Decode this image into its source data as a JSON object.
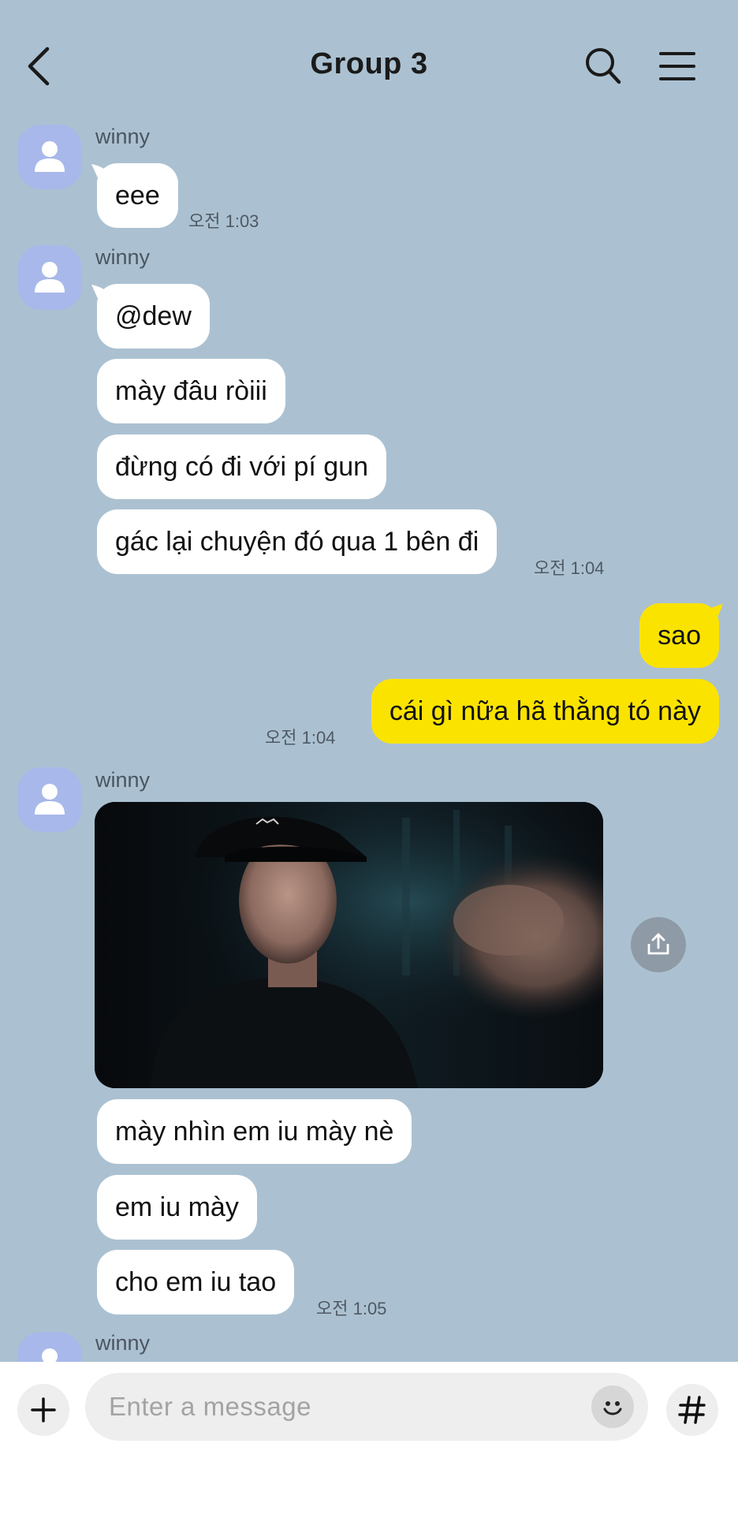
{
  "header": {
    "title": "Group 3",
    "back_icon": "chevron-left-icon",
    "search_icon": "search-icon",
    "menu_icon": "hamburger-menu-icon"
  },
  "messages": {
    "g1": {
      "sender": "winny",
      "b1": "eee",
      "time": "오전 1:03"
    },
    "g2": {
      "sender": "winny",
      "b1": "@dew",
      "b2": "mày đâu ròiii",
      "b3": "đừng có đi với pí gun",
      "b4": "gác lại chuyện đó qua 1 bên đi",
      "time": "오전 1:04"
    },
    "g3": {
      "b1": "sao",
      "b2": "cái gì nữa hã thằng tó này",
      "time": "오전 1:04"
    },
    "g4": {
      "sender": "winny",
      "b1": "mày nhìn em iu mày nè",
      "b2": "em iu mày",
      "b3": "cho em iu tao",
      "time": "오전 1:05"
    },
    "g5": {
      "sender": "winny"
    }
  },
  "composer": {
    "placeholder": "Enter a message",
    "plus_icon": "plus-icon",
    "emoji_icon": "emoji-icon",
    "hash_icon": "hashtag-icon"
  },
  "colors": {
    "background": "#abc1d1",
    "incoming_bubble": "#ffffff",
    "outgoing_bubble": "#fbe300",
    "avatar": "#a8b8ea"
  }
}
